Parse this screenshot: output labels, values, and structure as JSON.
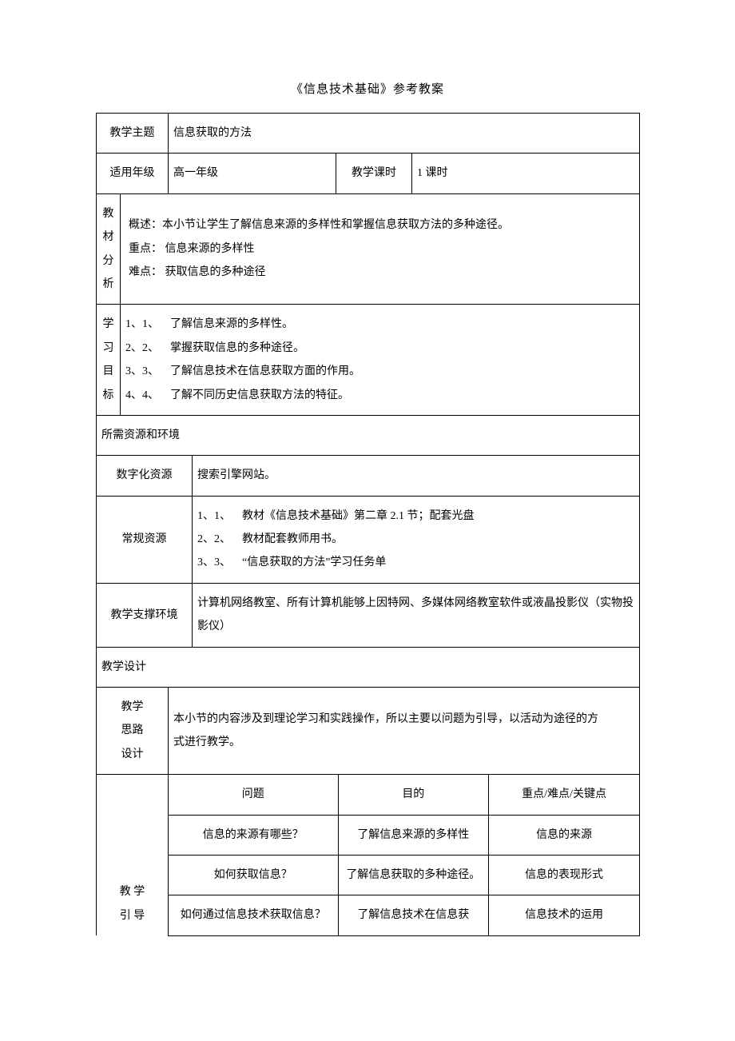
{
  "title": "《信息技术基础》参考教案",
  "rows": {
    "subject_label": "教学主题",
    "subject_value": "信息获取的方法",
    "grade_label": "适用年级",
    "grade_value": "高一年级",
    "period_label": "教学课时",
    "period_value": "1 课时"
  },
  "analysis": {
    "label": "教\n材\n分\n析",
    "overview": "概述：本小节让学生了解信息来源的多样性和掌握信息获取方法的多种途径。",
    "key": "重点：  信息来源的多样性",
    "difficult": "难点：  获取信息的多种途径"
  },
  "goals": {
    "label": "学\n习\n目\n标",
    "items": [
      "1、1、 了解信息来源的多样性。",
      "2、2、 掌握获取信息的多种途径。",
      "3、3、 了解信息技术在信息获取方面的作用。",
      "4、4、 了解不同历史信息获取方法的特征。"
    ]
  },
  "resources": {
    "header": "所需资源和环境",
    "digital_label": "数字化资源",
    "digital_value": "搜索引擎网站。",
    "normal_label": "常规资源",
    "normal_items": [
      "1、1、 教材《信息技术基础》第二章 2.1 节；配套光盘",
      "2、2、 教材配套教师用书。",
      "3、3、 “信息获取的方法”学习任务单"
    ],
    "env_label": "教学支撑环境",
    "env_value": "计算机网络教室、所有计算机能够上因特网、多媒体网络教室软件或液晶投影仪（实物投影仪）"
  },
  "design": {
    "header": "教学设计",
    "idea_label": "教学\n思路\n设计",
    "idea_value_l1": "本小节的内容涉及到理论学习和实践操作，所以主要以问题为引导，以活动为途径的方",
    "idea_value_l2": "式进行教学。",
    "guide_label": "教 学\n引 导",
    "table": {
      "headers": [
        "问题",
        "目的",
        "重点/难点/关键点"
      ],
      "rows": [
        [
          "信息的来源有哪些？",
          "了解信息来源的多样性",
          "信息的来源"
        ],
        [
          "如何获取信息？",
          "了解信息获取的多种途径。",
          "信息的表现形式"
        ],
        [
          "如何通过信息技术获取信息？",
          "了解信息技术在信息获",
          "信息技术的运用"
        ]
      ]
    }
  }
}
